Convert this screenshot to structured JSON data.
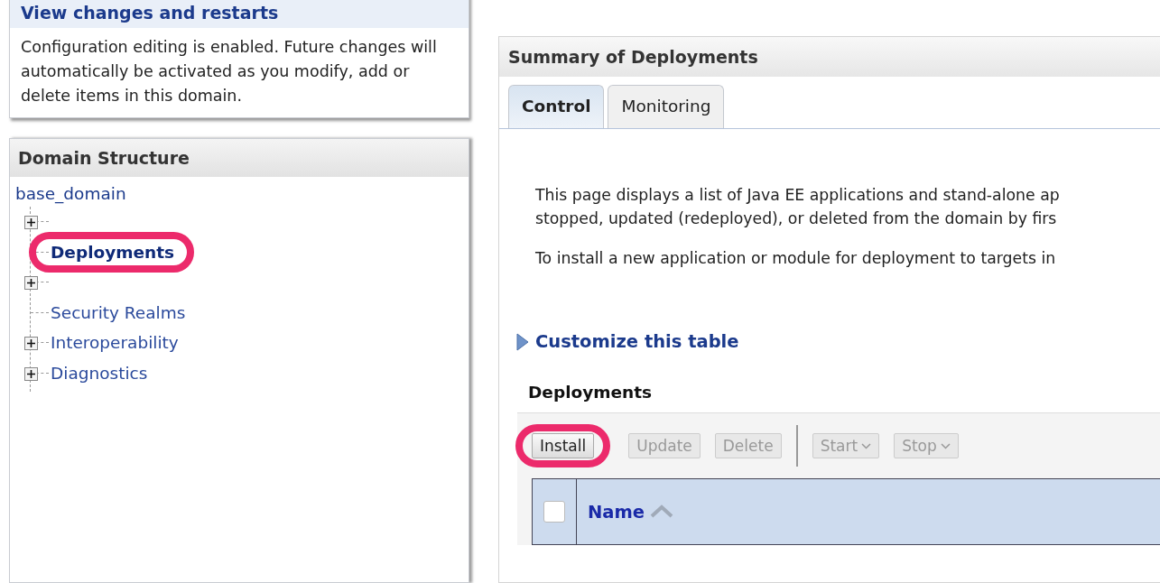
{
  "change_center": {
    "link": "View changes and restarts",
    "message": "Configuration editing is enabled. Future changes will automatically be activated as you modify, add or delete items in this domain."
  },
  "domain_structure": {
    "title": "Domain Structure",
    "root": "base_domain",
    "items": [
      {
        "expandable": true
      },
      {
        "label": "Deployments",
        "expandable": false,
        "selected": true,
        "highlighted": true
      },
      {
        "expandable": true
      },
      {
        "label": "Security Realms",
        "expandable": false,
        "selected": false
      },
      {
        "label": "Interoperability",
        "expandable": true,
        "selected": false
      },
      {
        "label": "Diagnostics",
        "expandable": true,
        "selected": false
      }
    ]
  },
  "summary": {
    "title": "Summary of Deployments",
    "tabs": [
      {
        "label": "Control",
        "selected": true
      },
      {
        "label": "Monitoring",
        "selected": false
      }
    ],
    "paragraphs": [
      [
        "This page displays a list of Java EE applications and stand-alone ap",
        "stopped, updated (redeployed), or deleted from the domain by firs"
      ],
      [
        "To install a new application or module for deployment to targets in"
      ]
    ],
    "customize_link": "Customize this table",
    "table_title": "Deployments",
    "toolbar": [
      {
        "kind": "button",
        "label": "Install",
        "disabled": false,
        "highlighted": true
      },
      {
        "kind": "button",
        "label": "Update",
        "disabled": true
      },
      {
        "kind": "button",
        "label": "Delete",
        "disabled": true
      },
      {
        "kind": "separator"
      },
      {
        "kind": "menu",
        "label": "Start",
        "disabled": true
      },
      {
        "kind": "menu",
        "label": "Stop",
        "disabled": true
      }
    ],
    "table": {
      "select_all_checked": false,
      "columns": [
        "Name"
      ]
    }
  }
}
